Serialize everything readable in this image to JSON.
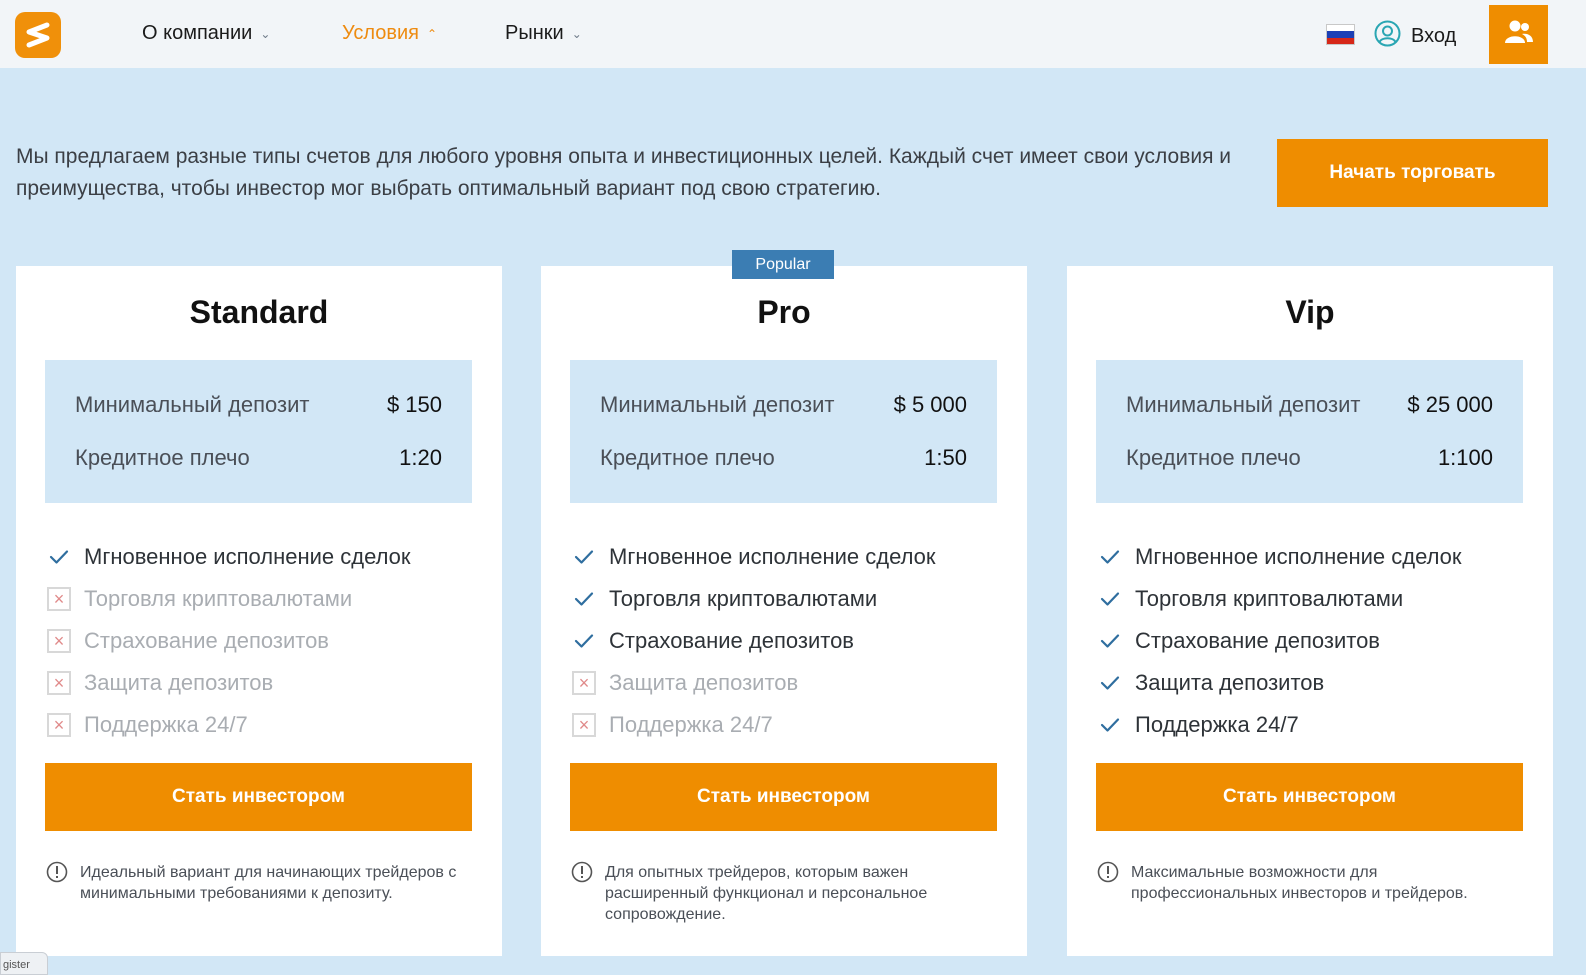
{
  "header": {
    "nav": [
      {
        "label": "О компании",
        "active": false
      },
      {
        "label": "Условия",
        "active": true
      },
      {
        "label": "Рынки",
        "active": false
      }
    ],
    "login_label": "Вход",
    "language_flag": "russia-flag-icon",
    "user_icon": "users-icon"
  },
  "intro": {
    "text": "Мы предлагаем разные типы счетов для любого уровня опыта и инвестиционных целей. Каждый счет имеет свои условия и преимущества, чтобы инвестор мог выбрать оптимальный вариант под свою стратегию.",
    "cta_label": "Начать торговать"
  },
  "popular_badge": "Popular",
  "plans": [
    {
      "name": "Standard",
      "deposit_label": "Минимальный депозит",
      "deposit_value": "$ 150",
      "leverage_label": "Кредитное плечо",
      "leverage_value": "1:20",
      "features": [
        {
          "label": "Мгновенное исполнение сделок",
          "included": true
        },
        {
          "label": "Торговля криптовалютами",
          "included": false
        },
        {
          "label": "Страхование депозитов",
          "included": false
        },
        {
          "label": "Защита депозитов",
          "included": false
        },
        {
          "label": "Поддержка 24/7",
          "included": false
        }
      ],
      "button_label": "Стать инвестором",
      "note": "Идеальный вариант для начинающих трейдеров с минимальными требованиями к депозиту."
    },
    {
      "name": "Pro",
      "deposit_label": "Минимальный депозит",
      "deposit_value": "$ 5 000",
      "leverage_label": "Кредитное плечо",
      "leverage_value": "1:50",
      "features": [
        {
          "label": "Мгновенное исполнение сделок",
          "included": true
        },
        {
          "label": "Торговля криптовалютами",
          "included": true
        },
        {
          "label": "Страхование депозитов",
          "included": true
        },
        {
          "label": "Защита депозитов",
          "included": false
        },
        {
          "label": "Поддержка 24/7",
          "included": false
        }
      ],
      "button_label": "Стать инвестором",
      "note": "Для опытных трейдеров, которым важен расширенный функционал и персональное сопровождение."
    },
    {
      "name": "Vip",
      "deposit_label": "Минимальный депозит",
      "deposit_value": "$ 25 000",
      "leverage_label": "Кредитное плечо",
      "leverage_value": "1:100",
      "features": [
        {
          "label": "Мгновенное исполнение сделок",
          "included": true
        },
        {
          "label": "Торговля криптовалютами",
          "included": true
        },
        {
          "label": "Страхование депозитов",
          "included": true
        },
        {
          "label": "Защита депозитов",
          "included": true
        },
        {
          "label": "Поддержка 24/7",
          "included": true
        }
      ],
      "button_label": "Стать инвестором",
      "note": "Максимальные возможности для профессиональных инвесторов и трейдеров."
    }
  ],
  "corner_tab_text": "gister",
  "colors": {
    "accent": "#ef8d00",
    "badge": "#3b7db3",
    "page_bg": "#d2e7f6",
    "check": "#2f6e9f"
  }
}
